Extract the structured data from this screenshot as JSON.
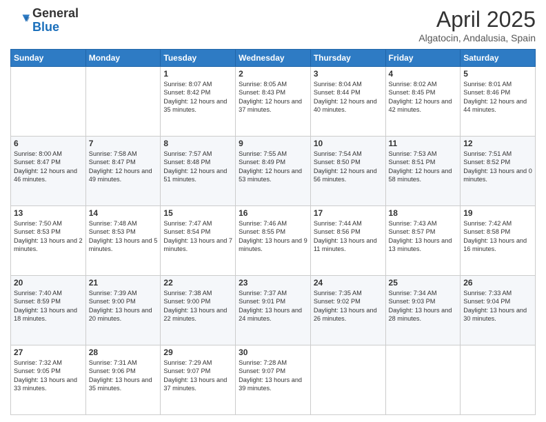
{
  "header": {
    "logo_line1": "General",
    "logo_line2": "Blue",
    "month_title": "April 2025",
    "subtitle": "Algatocin, Andalusia, Spain"
  },
  "weekdays": [
    "Sunday",
    "Monday",
    "Tuesday",
    "Wednesday",
    "Thursday",
    "Friday",
    "Saturday"
  ],
  "rows": [
    [
      {
        "day": "",
        "content": ""
      },
      {
        "day": "",
        "content": ""
      },
      {
        "day": "1",
        "content": "Sunrise: 8:07 AM\nSunset: 8:42 PM\nDaylight: 12 hours and 35 minutes."
      },
      {
        "day": "2",
        "content": "Sunrise: 8:05 AM\nSunset: 8:43 PM\nDaylight: 12 hours and 37 minutes."
      },
      {
        "day": "3",
        "content": "Sunrise: 8:04 AM\nSunset: 8:44 PM\nDaylight: 12 hours and 40 minutes."
      },
      {
        "day": "4",
        "content": "Sunrise: 8:02 AM\nSunset: 8:45 PM\nDaylight: 12 hours and 42 minutes."
      },
      {
        "day": "5",
        "content": "Sunrise: 8:01 AM\nSunset: 8:46 PM\nDaylight: 12 hours and 44 minutes."
      }
    ],
    [
      {
        "day": "6",
        "content": "Sunrise: 8:00 AM\nSunset: 8:47 PM\nDaylight: 12 hours and 46 minutes."
      },
      {
        "day": "7",
        "content": "Sunrise: 7:58 AM\nSunset: 8:47 PM\nDaylight: 12 hours and 49 minutes."
      },
      {
        "day": "8",
        "content": "Sunrise: 7:57 AM\nSunset: 8:48 PM\nDaylight: 12 hours and 51 minutes."
      },
      {
        "day": "9",
        "content": "Sunrise: 7:55 AM\nSunset: 8:49 PM\nDaylight: 12 hours and 53 minutes."
      },
      {
        "day": "10",
        "content": "Sunrise: 7:54 AM\nSunset: 8:50 PM\nDaylight: 12 hours and 56 minutes."
      },
      {
        "day": "11",
        "content": "Sunrise: 7:53 AM\nSunset: 8:51 PM\nDaylight: 12 hours and 58 minutes."
      },
      {
        "day": "12",
        "content": "Sunrise: 7:51 AM\nSunset: 8:52 PM\nDaylight: 13 hours and 0 minutes."
      }
    ],
    [
      {
        "day": "13",
        "content": "Sunrise: 7:50 AM\nSunset: 8:53 PM\nDaylight: 13 hours and 2 minutes."
      },
      {
        "day": "14",
        "content": "Sunrise: 7:48 AM\nSunset: 8:53 PM\nDaylight: 13 hours and 5 minutes."
      },
      {
        "day": "15",
        "content": "Sunrise: 7:47 AM\nSunset: 8:54 PM\nDaylight: 13 hours and 7 minutes."
      },
      {
        "day": "16",
        "content": "Sunrise: 7:46 AM\nSunset: 8:55 PM\nDaylight: 13 hours and 9 minutes."
      },
      {
        "day": "17",
        "content": "Sunrise: 7:44 AM\nSunset: 8:56 PM\nDaylight: 13 hours and 11 minutes."
      },
      {
        "day": "18",
        "content": "Sunrise: 7:43 AM\nSunset: 8:57 PM\nDaylight: 13 hours and 13 minutes."
      },
      {
        "day": "19",
        "content": "Sunrise: 7:42 AM\nSunset: 8:58 PM\nDaylight: 13 hours and 16 minutes."
      }
    ],
    [
      {
        "day": "20",
        "content": "Sunrise: 7:40 AM\nSunset: 8:59 PM\nDaylight: 13 hours and 18 minutes."
      },
      {
        "day": "21",
        "content": "Sunrise: 7:39 AM\nSunset: 9:00 PM\nDaylight: 13 hours and 20 minutes."
      },
      {
        "day": "22",
        "content": "Sunrise: 7:38 AM\nSunset: 9:00 PM\nDaylight: 13 hours and 22 minutes."
      },
      {
        "day": "23",
        "content": "Sunrise: 7:37 AM\nSunset: 9:01 PM\nDaylight: 13 hours and 24 minutes."
      },
      {
        "day": "24",
        "content": "Sunrise: 7:35 AM\nSunset: 9:02 PM\nDaylight: 13 hours and 26 minutes."
      },
      {
        "day": "25",
        "content": "Sunrise: 7:34 AM\nSunset: 9:03 PM\nDaylight: 13 hours and 28 minutes."
      },
      {
        "day": "26",
        "content": "Sunrise: 7:33 AM\nSunset: 9:04 PM\nDaylight: 13 hours and 30 minutes."
      }
    ],
    [
      {
        "day": "27",
        "content": "Sunrise: 7:32 AM\nSunset: 9:05 PM\nDaylight: 13 hours and 33 minutes."
      },
      {
        "day": "28",
        "content": "Sunrise: 7:31 AM\nSunset: 9:06 PM\nDaylight: 13 hours and 35 minutes."
      },
      {
        "day": "29",
        "content": "Sunrise: 7:29 AM\nSunset: 9:07 PM\nDaylight: 13 hours and 37 minutes."
      },
      {
        "day": "30",
        "content": "Sunrise: 7:28 AM\nSunset: 9:07 PM\nDaylight: 13 hours and 39 minutes."
      },
      {
        "day": "",
        "content": ""
      },
      {
        "day": "",
        "content": ""
      },
      {
        "day": "",
        "content": ""
      }
    ]
  ]
}
